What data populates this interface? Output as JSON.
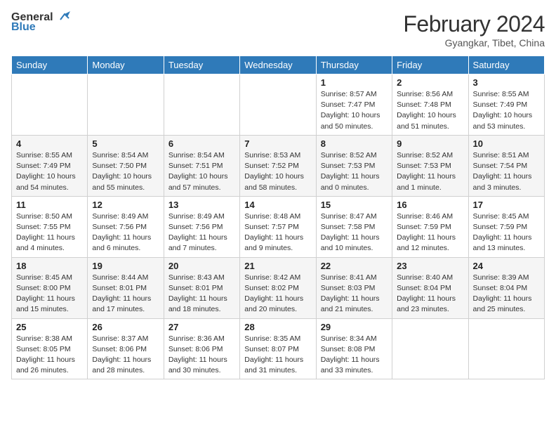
{
  "header": {
    "logo_general": "General",
    "logo_blue": "Blue",
    "title": "February 2024",
    "subtitle": "Gyangkar, Tibet, China"
  },
  "weekdays": [
    "Sunday",
    "Monday",
    "Tuesday",
    "Wednesday",
    "Thursday",
    "Friday",
    "Saturday"
  ],
  "weeks": [
    [
      null,
      null,
      null,
      null,
      {
        "day": 1,
        "sunrise": "Sunrise: 8:57 AM",
        "sunset": "Sunset: 7:47 PM",
        "daylight": "Daylight: 10 hours and 50 minutes."
      },
      {
        "day": 2,
        "sunrise": "Sunrise: 8:56 AM",
        "sunset": "Sunset: 7:48 PM",
        "daylight": "Daylight: 10 hours and 51 minutes."
      },
      {
        "day": 3,
        "sunrise": "Sunrise: 8:55 AM",
        "sunset": "Sunset: 7:49 PM",
        "daylight": "Daylight: 10 hours and 53 minutes."
      }
    ],
    [
      {
        "day": 4,
        "sunrise": "Sunrise: 8:55 AM",
        "sunset": "Sunset: 7:49 PM",
        "daylight": "Daylight: 10 hours and 54 minutes."
      },
      {
        "day": 5,
        "sunrise": "Sunrise: 8:54 AM",
        "sunset": "Sunset: 7:50 PM",
        "daylight": "Daylight: 10 hours and 55 minutes."
      },
      {
        "day": 6,
        "sunrise": "Sunrise: 8:54 AM",
        "sunset": "Sunset: 7:51 PM",
        "daylight": "Daylight: 10 hours and 57 minutes."
      },
      {
        "day": 7,
        "sunrise": "Sunrise: 8:53 AM",
        "sunset": "Sunset: 7:52 PM",
        "daylight": "Daylight: 10 hours and 58 minutes."
      },
      {
        "day": 8,
        "sunrise": "Sunrise: 8:52 AM",
        "sunset": "Sunset: 7:53 PM",
        "daylight": "Daylight: 11 hours and 0 minutes."
      },
      {
        "day": 9,
        "sunrise": "Sunrise: 8:52 AM",
        "sunset": "Sunset: 7:53 PM",
        "daylight": "Daylight: 11 hours and 1 minute."
      },
      {
        "day": 10,
        "sunrise": "Sunrise: 8:51 AM",
        "sunset": "Sunset: 7:54 PM",
        "daylight": "Daylight: 11 hours and 3 minutes."
      }
    ],
    [
      {
        "day": 11,
        "sunrise": "Sunrise: 8:50 AM",
        "sunset": "Sunset: 7:55 PM",
        "daylight": "Daylight: 11 hours and 4 minutes."
      },
      {
        "day": 12,
        "sunrise": "Sunrise: 8:49 AM",
        "sunset": "Sunset: 7:56 PM",
        "daylight": "Daylight: 11 hours and 6 minutes."
      },
      {
        "day": 13,
        "sunrise": "Sunrise: 8:49 AM",
        "sunset": "Sunset: 7:56 PM",
        "daylight": "Daylight: 11 hours and 7 minutes."
      },
      {
        "day": 14,
        "sunrise": "Sunrise: 8:48 AM",
        "sunset": "Sunset: 7:57 PM",
        "daylight": "Daylight: 11 hours and 9 minutes."
      },
      {
        "day": 15,
        "sunrise": "Sunrise: 8:47 AM",
        "sunset": "Sunset: 7:58 PM",
        "daylight": "Daylight: 11 hours and 10 minutes."
      },
      {
        "day": 16,
        "sunrise": "Sunrise: 8:46 AM",
        "sunset": "Sunset: 7:59 PM",
        "daylight": "Daylight: 11 hours and 12 minutes."
      },
      {
        "day": 17,
        "sunrise": "Sunrise: 8:45 AM",
        "sunset": "Sunset: 7:59 PM",
        "daylight": "Daylight: 11 hours and 13 minutes."
      }
    ],
    [
      {
        "day": 18,
        "sunrise": "Sunrise: 8:45 AM",
        "sunset": "Sunset: 8:00 PM",
        "daylight": "Daylight: 11 hours and 15 minutes."
      },
      {
        "day": 19,
        "sunrise": "Sunrise: 8:44 AM",
        "sunset": "Sunset: 8:01 PM",
        "daylight": "Daylight: 11 hours and 17 minutes."
      },
      {
        "day": 20,
        "sunrise": "Sunrise: 8:43 AM",
        "sunset": "Sunset: 8:01 PM",
        "daylight": "Daylight: 11 hours and 18 minutes."
      },
      {
        "day": 21,
        "sunrise": "Sunrise: 8:42 AM",
        "sunset": "Sunset: 8:02 PM",
        "daylight": "Daylight: 11 hours and 20 minutes."
      },
      {
        "day": 22,
        "sunrise": "Sunrise: 8:41 AM",
        "sunset": "Sunset: 8:03 PM",
        "daylight": "Daylight: 11 hours and 21 minutes."
      },
      {
        "day": 23,
        "sunrise": "Sunrise: 8:40 AM",
        "sunset": "Sunset: 8:04 PM",
        "daylight": "Daylight: 11 hours and 23 minutes."
      },
      {
        "day": 24,
        "sunrise": "Sunrise: 8:39 AM",
        "sunset": "Sunset: 8:04 PM",
        "daylight": "Daylight: 11 hours and 25 minutes."
      }
    ],
    [
      {
        "day": 25,
        "sunrise": "Sunrise: 8:38 AM",
        "sunset": "Sunset: 8:05 PM",
        "daylight": "Daylight: 11 hours and 26 minutes."
      },
      {
        "day": 26,
        "sunrise": "Sunrise: 8:37 AM",
        "sunset": "Sunset: 8:06 PM",
        "daylight": "Daylight: 11 hours and 28 minutes."
      },
      {
        "day": 27,
        "sunrise": "Sunrise: 8:36 AM",
        "sunset": "Sunset: 8:06 PM",
        "daylight": "Daylight: 11 hours and 30 minutes."
      },
      {
        "day": 28,
        "sunrise": "Sunrise: 8:35 AM",
        "sunset": "Sunset: 8:07 PM",
        "daylight": "Daylight: 11 hours and 31 minutes."
      },
      {
        "day": 29,
        "sunrise": "Sunrise: 8:34 AM",
        "sunset": "Sunset: 8:08 PM",
        "daylight": "Daylight: 11 hours and 33 minutes."
      },
      null,
      null
    ]
  ]
}
